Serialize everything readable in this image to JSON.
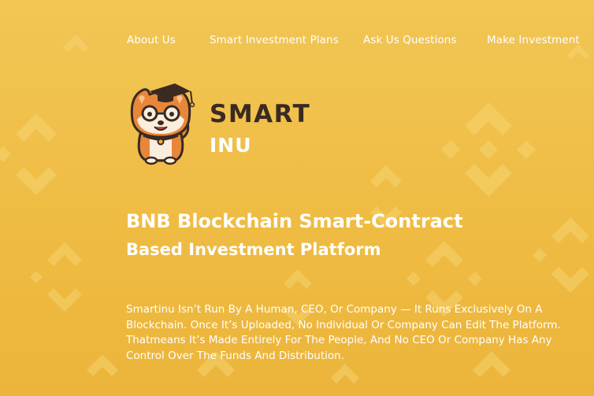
{
  "nav": {
    "items": [
      {
        "label": "About Us"
      },
      {
        "label": "Smart Investment Plans"
      },
      {
        "label": "Ask Us Questions"
      },
      {
        "label": "Make Investment"
      }
    ]
  },
  "logo": {
    "word_1": "SMART",
    "word_2": "INU",
    "icon": "shiba-inu-graduate-mascot"
  },
  "hero": {
    "title": "BNB Blockchain Smart-Contract",
    "subtitle": "Based Investment Platform",
    "description_lines": [
      "Smartinu Isn’t Run By A Human, CEO, Or Company — It Runs Exclusively On A",
      "Blockchain. Once It’s Uploaded, No Individual Or Company Can Edit The Platform.",
      "Thatmeans It’s Made Entirely For The People, And No CEO Or Company Has Any",
      "Control Over The Funds And Distribution."
    ]
  },
  "colors": {
    "background_top": "#f1c655",
    "background_bottom": "#ecb43a",
    "pattern": "#f5cf6a",
    "logo_dark_text": "#3a2a22",
    "text_light": "#ffffff"
  }
}
